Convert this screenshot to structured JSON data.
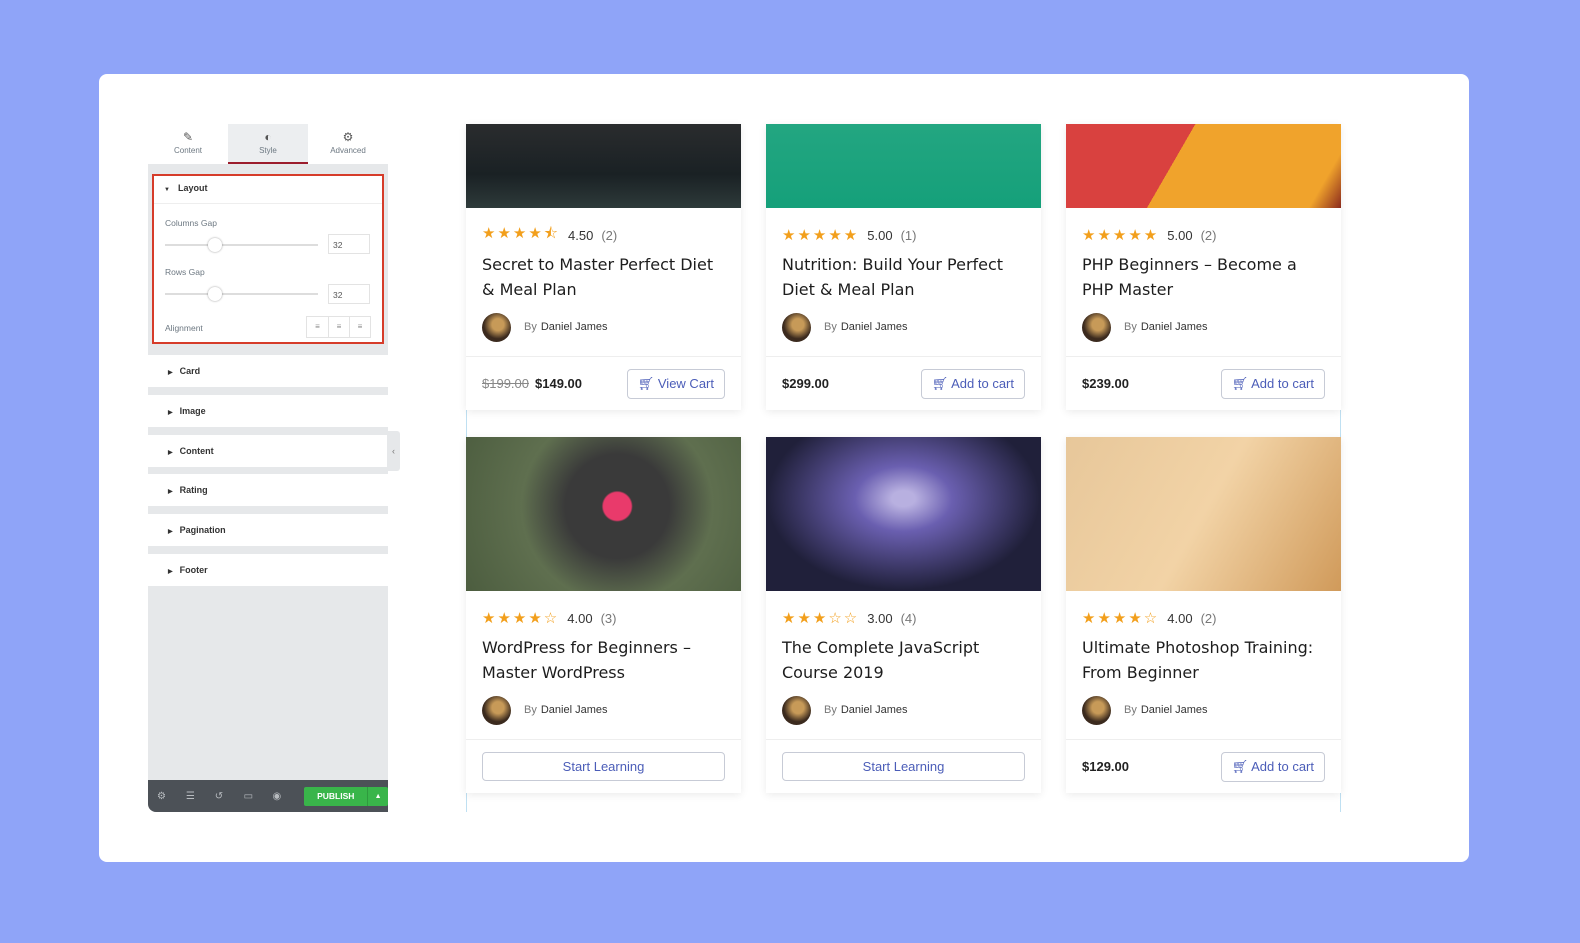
{
  "panel": {
    "tabs": [
      {
        "label": "Content",
        "icon": "pencil-icon"
      },
      {
        "label": "Style",
        "icon": "contrast-icon"
      },
      {
        "label": "Advanced",
        "icon": "gear-icon"
      }
    ],
    "layout": {
      "title": "Layout",
      "columns_gap_label": "Columns Gap",
      "columns_gap": "32",
      "rows_gap_label": "Rows Gap",
      "rows_gap": "32",
      "alignment_label": "Alignment"
    },
    "sections": [
      "Card",
      "Image",
      "Content",
      "Rating",
      "Pagination",
      "Footer"
    ],
    "publish": "PUBLISH"
  },
  "colors": {
    "background": "#8fa4f8",
    "accent": "#d63c2a",
    "publish": "#39b54a",
    "star": "#f29f1c"
  },
  "cards": [
    {
      "stars": "★★★★⯪",
      "rating": "4.50",
      "count": "(2)",
      "title": "Secret to Master Perfect Diet & Meal Plan",
      "by": "By",
      "author": "Daniel James",
      "old_price": "$199.00",
      "price": "$149.00",
      "button": "View Cart",
      "cart_icon": true
    },
    {
      "stars": "★★★★★",
      "rating": "5.00",
      "count": "(1)",
      "title": "Nutrition: Build Your Perfect Diet & Meal Plan",
      "by": "By",
      "author": "Daniel James",
      "price": "$299.00",
      "button": "Add to cart",
      "cart_icon": true
    },
    {
      "stars": "★★★★★",
      "rating": "5.00",
      "count": "(2)",
      "title": "PHP Beginners – Become a PHP Master",
      "by": "By",
      "author": "Daniel James",
      "price": "$239.00",
      "button": "Add to cart",
      "cart_icon": true
    },
    {
      "stars": "★★★★☆",
      "rating": "4.00",
      "count": "(3)",
      "title": "WordPress for Beginners – Master WordPress",
      "by": "By",
      "author": "Daniel James",
      "button": "Start Learning"
    },
    {
      "stars": "★★★☆☆",
      "rating": "3.00",
      "count": "(4)",
      "title": "The Complete JavaScript Course 2019",
      "by": "By",
      "author": "Daniel James",
      "button": "Start Learning"
    },
    {
      "stars": "★★★★☆",
      "rating": "4.00",
      "count": "(2)",
      "title": "Ultimate Photoshop Training: From Beginner",
      "by": "By",
      "author": "Daniel James",
      "price": "$129.00",
      "button": "Add to cart",
      "cart_icon": true
    }
  ]
}
